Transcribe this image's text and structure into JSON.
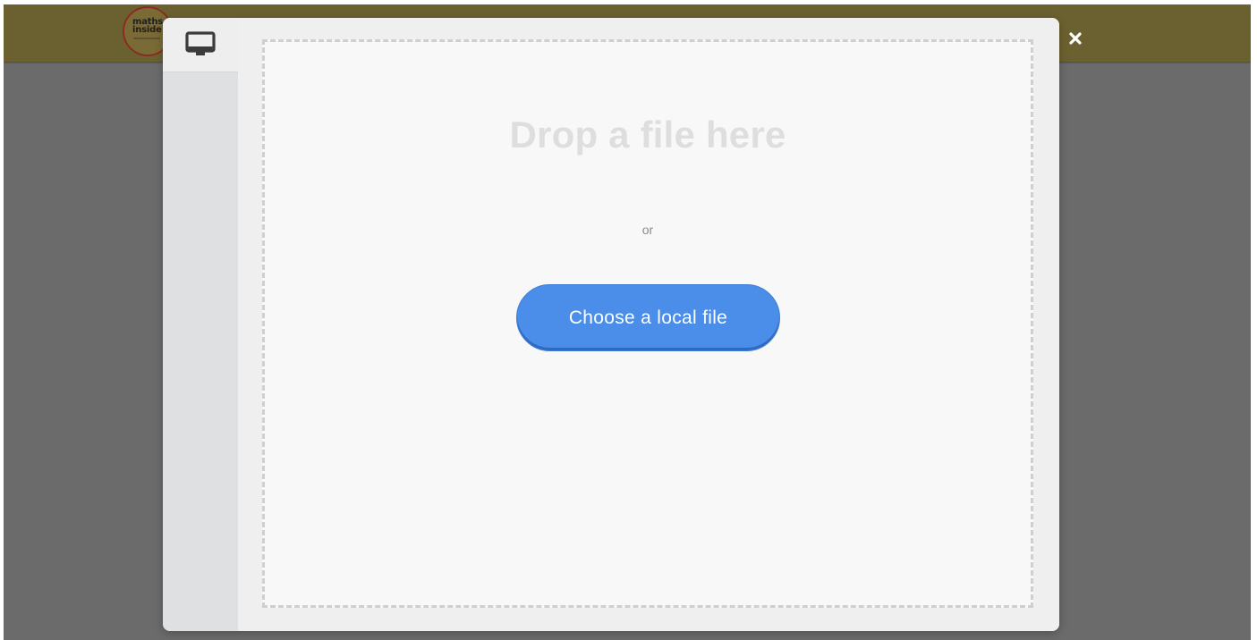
{
  "app": {
    "logo": {
      "text": "maths\ninside",
      "icon": "maths-inside-logo"
    },
    "colors": {
      "topbar": "#6b6130",
      "overlay": "#6b6b6b",
      "primary_button": "#4a8ee9"
    }
  },
  "modal": {
    "close_icon": "close-icon",
    "sidebar": {
      "tabs": [
        {
          "icon": "monitor-icon",
          "selected": true
        }
      ]
    },
    "dropzone": {
      "title": "Drop a file here",
      "or_text": "or",
      "button_label": "Choose a local file"
    }
  }
}
